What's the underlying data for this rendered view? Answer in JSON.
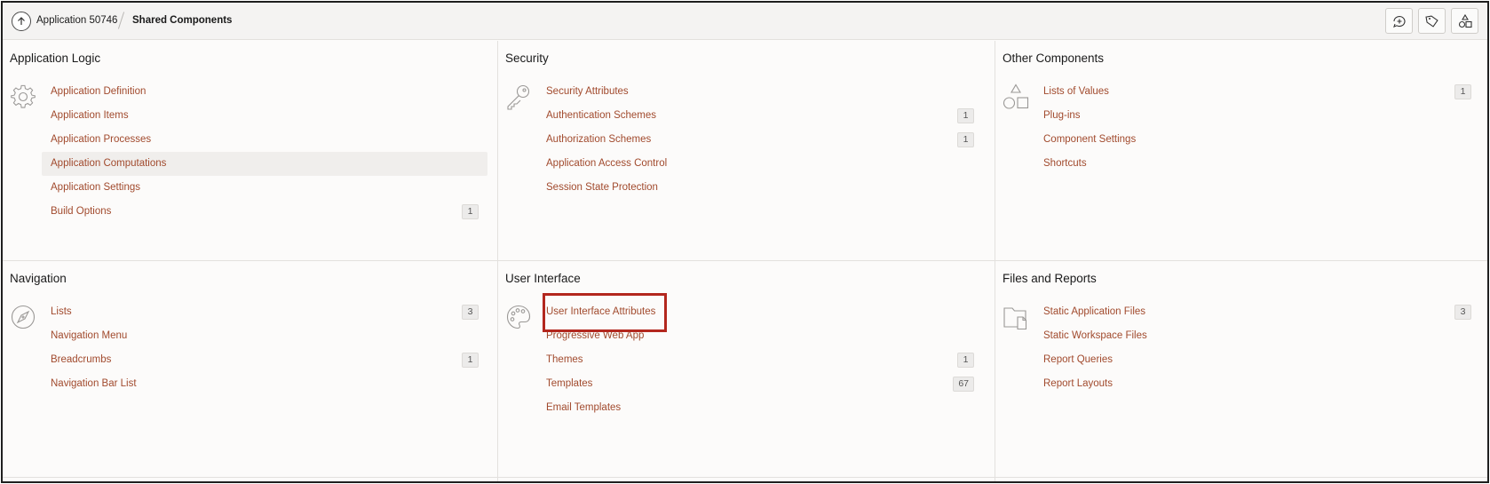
{
  "topbar": {
    "breadcrumb_app": "Application 50746",
    "breadcrumb_current": "Shared Components",
    "icons": [
      "comment-icon",
      "tag-icon",
      "shapes-icon"
    ]
  },
  "panels": {
    "app_logic": {
      "title": "Application Logic",
      "icon": "gear-icon",
      "items": [
        {
          "label": "Application Definition",
          "badge": ""
        },
        {
          "label": "Application Items",
          "badge": ""
        },
        {
          "label": "Application Processes",
          "badge": ""
        },
        {
          "label": "Application Computations",
          "badge": ""
        },
        {
          "label": "Application Settings",
          "badge": ""
        },
        {
          "label": "Build Options",
          "badge": "1"
        }
      ]
    },
    "security": {
      "title": "Security",
      "icon": "key-icon",
      "items": [
        {
          "label": "Security Attributes",
          "badge": ""
        },
        {
          "label": "Authentication Schemes",
          "badge": "1"
        },
        {
          "label": "Authorization Schemes",
          "badge": "1"
        },
        {
          "label": "Application Access Control",
          "badge": ""
        },
        {
          "label": "Session State Protection",
          "badge": ""
        }
      ]
    },
    "other": {
      "title": "Other Components",
      "icon": "shapes-icon",
      "items": [
        {
          "label": "Lists of Values",
          "badge": "1"
        },
        {
          "label": "Plug-ins",
          "badge": ""
        },
        {
          "label": "Component Settings",
          "badge": ""
        },
        {
          "label": "Shortcuts",
          "badge": ""
        }
      ]
    },
    "navigation": {
      "title": "Navigation",
      "icon": "compass-icon",
      "items": [
        {
          "label": "Lists",
          "badge": "3"
        },
        {
          "label": "Navigation Menu",
          "badge": ""
        },
        {
          "label": "Breadcrumbs",
          "badge": "1"
        },
        {
          "label": "Navigation Bar List",
          "badge": ""
        }
      ]
    },
    "ui": {
      "title": "User Interface",
      "icon": "palette-icon",
      "items": [
        {
          "label": "User Interface Attributes",
          "badge": ""
        },
        {
          "label": "Progressive Web App",
          "badge": ""
        },
        {
          "label": "Themes",
          "badge": "1"
        },
        {
          "label": "Templates",
          "badge": "67"
        },
        {
          "label": "Email Templates",
          "badge": ""
        }
      ]
    },
    "files": {
      "title": "Files and Reports",
      "icon": "folder-icon",
      "items": [
        {
          "label": "Static Application Files",
          "badge": "3"
        },
        {
          "label": "Static Workspace Files",
          "badge": ""
        },
        {
          "label": "Report Queries",
          "badge": ""
        },
        {
          "label": "Report Layouts",
          "badge": ""
        }
      ]
    }
  },
  "colors": {
    "link": "#a14a2d",
    "highlight_box": "#b3271e",
    "hover_row": "#f0eeec"
  }
}
